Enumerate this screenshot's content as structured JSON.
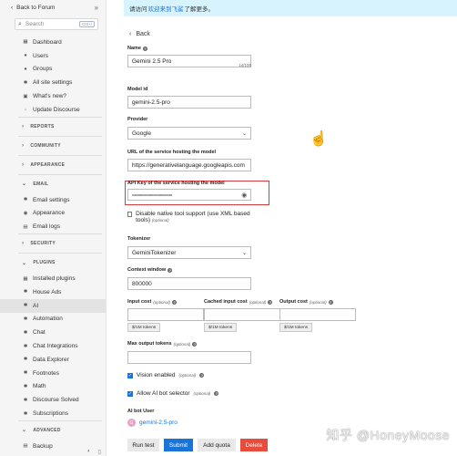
{
  "sidebar": {
    "back_label": "Back to Forum",
    "search_placeholder": "Search",
    "search_kbd": "Ctrl+/",
    "groups": [
      {
        "items": [
          {
            "icon": "dashboard-icon",
            "glyph": "▦",
            "label": "Dashboard"
          },
          {
            "icon": "users-icon",
            "glyph": "●",
            "label": "Users"
          },
          {
            "icon": "groups-icon",
            "glyph": "●",
            "label": "Groups"
          },
          {
            "icon": "gear-icon",
            "glyph": "✱",
            "label": "All site settings"
          },
          {
            "icon": "gift-icon",
            "glyph": "▣",
            "label": "What's new?"
          },
          {
            "icon": "download-icon",
            "glyph": "↓",
            "label": "Update Discourse"
          }
        ]
      }
    ],
    "sections": [
      {
        "label": "REPORTS"
      },
      {
        "label": "COMMUNITY"
      },
      {
        "label": "APPEARANCE"
      }
    ],
    "email_section": "EMAIL",
    "email_items": [
      {
        "icon": "gear-icon",
        "glyph": "✱",
        "label": "Email settings"
      },
      {
        "icon": "palette-icon",
        "glyph": "◉",
        "label": "Appearance"
      },
      {
        "icon": "server-icon",
        "glyph": "▤",
        "label": "Email logs"
      }
    ],
    "security_section": "SECURITY",
    "plugins_section": "PLUGINS",
    "plugin_items": [
      {
        "icon": "puzzle-icon",
        "glyph": "▦",
        "label": "Installed plugins"
      },
      {
        "icon": "house-icon",
        "glyph": "✱",
        "label": "House Ads"
      },
      {
        "icon": "gear-icon",
        "glyph": "✱",
        "label": "AI",
        "active": true
      },
      {
        "icon": "gear-icon",
        "glyph": "✱",
        "label": "Automation"
      },
      {
        "icon": "gear-icon",
        "glyph": "✱",
        "label": "Chat"
      },
      {
        "icon": "gear-icon",
        "glyph": "✱",
        "label": "Chat Integrations"
      },
      {
        "icon": "gear-icon",
        "glyph": "✱",
        "label": "Data Explorer"
      },
      {
        "icon": "gear-icon",
        "glyph": "✱",
        "label": "Footnotes"
      },
      {
        "icon": "gear-icon",
        "glyph": "✱",
        "label": "Math"
      },
      {
        "icon": "gear-icon",
        "glyph": "✱",
        "label": "Discourse Solved"
      },
      {
        "icon": "gear-icon",
        "glyph": "✱",
        "label": "Subscriptions"
      }
    ],
    "advanced_section": "ADVANCED",
    "advanced_items": [
      {
        "icon": "backup-icon",
        "glyph": "▤",
        "label": "Backup"
      }
    ]
  },
  "banner": {
    "prefix": "请访问",
    "link": "欢迎来到飞鲨",
    "suffix": "了解更多。"
  },
  "form": {
    "back_label": "Back",
    "name_label": "Name",
    "name_value": "Gemini 2.5 Pro",
    "name_counter": "14/100",
    "model_id_label": "Model id",
    "model_id_value": "gemini-2.5-pro",
    "provider_label": "Provider",
    "provider_value": "Google",
    "url_label": "URL of the service hosting the model",
    "url_value": "https://generativelanguage.googleapis.com",
    "api_key_label": "API Key of the service hosting the model",
    "api_key_value": "••••••••••••••••••••••••••••••••••••••••",
    "native_tools_label": "Disable native tool support (use XML based tools)",
    "native_tools_opt": "(optional)",
    "tokenizer_label": "Tokenizer",
    "tokenizer_value": "GeminiTokenizer",
    "context_label": "Context window",
    "context_value": "800000",
    "input_cost_label": "Input cost",
    "cached_cost_label": "Cached input cost",
    "output_cost_label": "Output cost",
    "optional": "(optional)",
    "per_tokens": "$/1M tokens",
    "max_output_label": "Max output tokens",
    "vision_label": "Vision enabled",
    "selector_label": "Allow AI bot selector",
    "bot_user_label": "AI bot User",
    "bot_user_value": "gemini-2.5-pro",
    "bot_user_initial": "G"
  },
  "buttons": {
    "run_test": "Run test",
    "submit": "Submit",
    "add_quota": "Add quota",
    "delete": "Delete"
  },
  "watermark": "知乎 @HoneyMoose"
}
